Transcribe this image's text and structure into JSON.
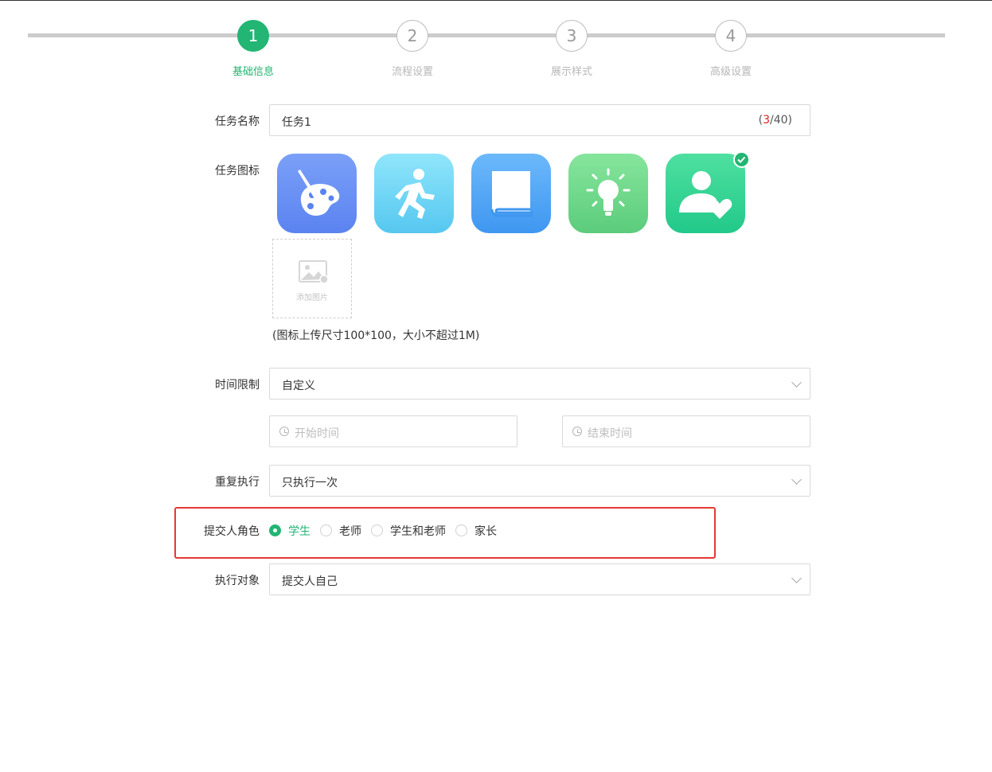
{
  "steps": [
    {
      "number": "1",
      "label": "基础信息",
      "active": true
    },
    {
      "number": "2",
      "label": "流程设置",
      "active": false
    },
    {
      "number": "3",
      "label": "展示样式",
      "active": false
    },
    {
      "number": "4",
      "label": "高级设置",
      "active": false
    }
  ],
  "task_name": {
    "label": "任务名称",
    "value": "任务1",
    "counter_open": "(",
    "counter_count": "3",
    "counter_rest": "/40)"
  },
  "task_icon": {
    "label": "任务图标",
    "icons": [
      "palette-icon",
      "running-person-icon",
      "book-icon",
      "lightbulb-icon",
      "user-heart-icon"
    ],
    "selected_index": 4,
    "upload_label": "添加图片",
    "hint": "(图标上传尺寸100*100，大小不超过1M)"
  },
  "time_limit": {
    "label": "时间限制",
    "value": "自定义",
    "start_placeholder": "开始时间",
    "end_placeholder": "结束时间"
  },
  "repeat": {
    "label": "重复执行",
    "value": "只执行一次"
  },
  "submitter_role": {
    "label": "提交人角色",
    "options": [
      "学生",
      "老师",
      "学生和老师",
      "家长"
    ],
    "selected": "学生"
  },
  "target": {
    "label": "执行对象",
    "value": "提交人自己"
  },
  "colors": {
    "accent": "#22b573",
    "highlight_border": "#e53935"
  }
}
